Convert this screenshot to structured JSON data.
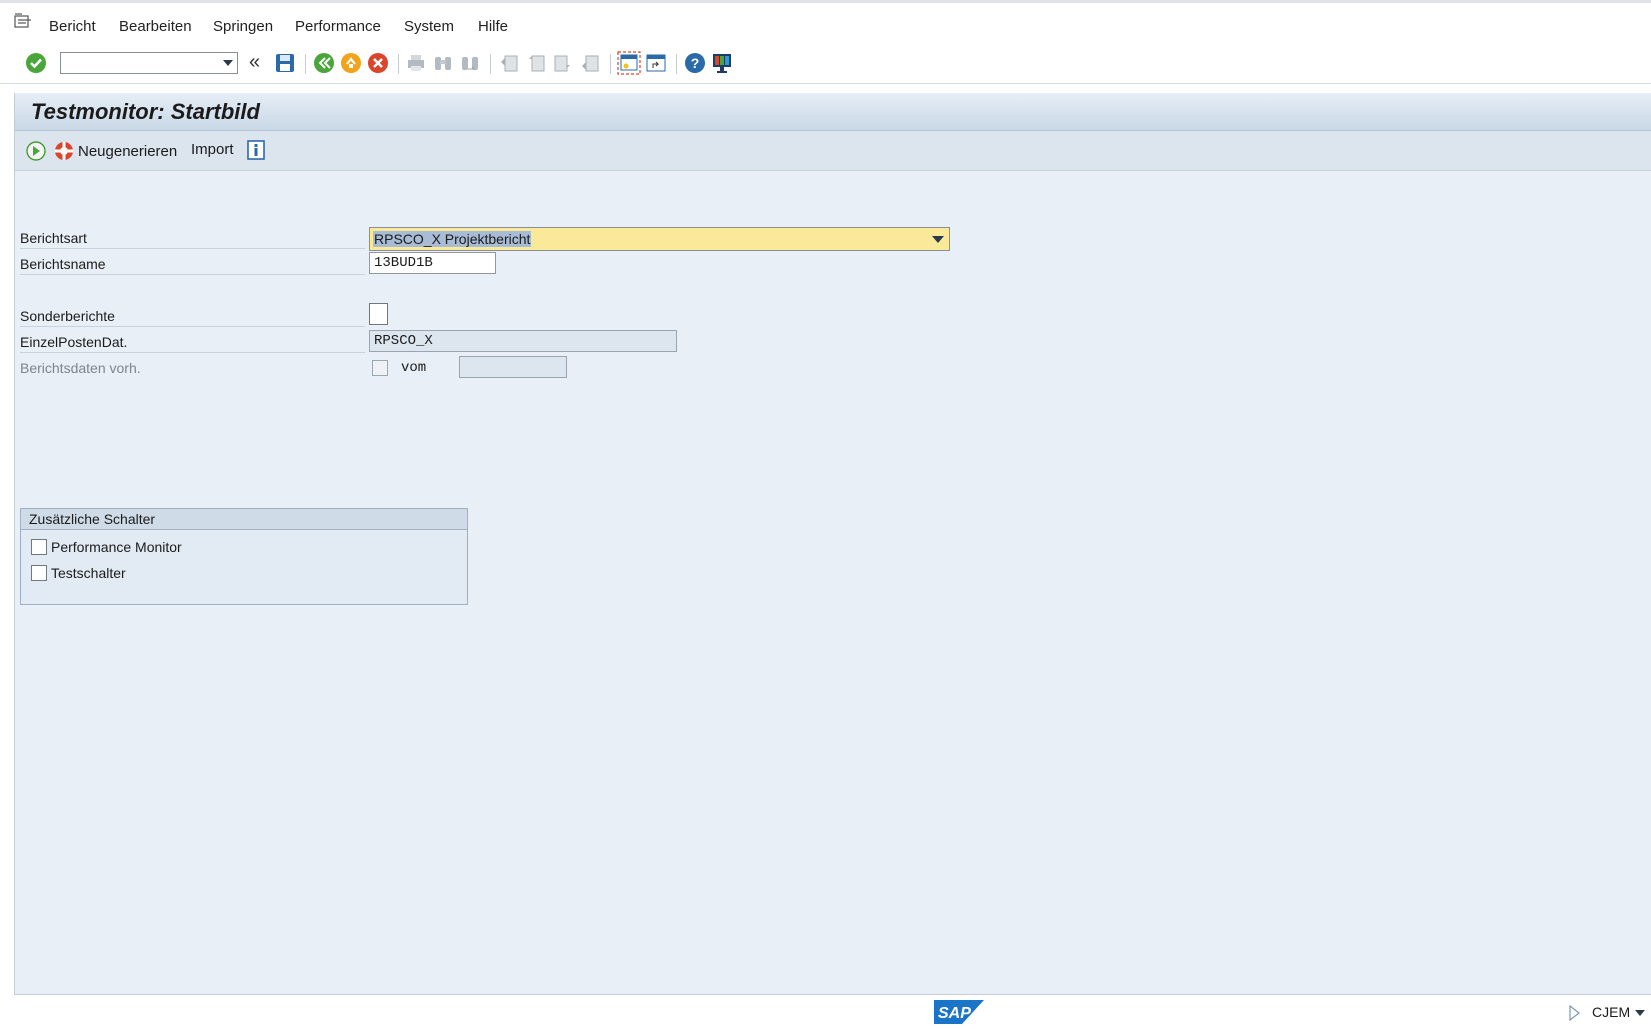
{
  "menubar": {
    "items": [
      "Bericht",
      "Bearbeiten",
      "Springen",
      "Performance",
      "System",
      "Hilfe"
    ]
  },
  "toolbar": {
    "command_field_value": "",
    "collapse_glyph": "«",
    "icons": [
      "enter-icon",
      "save-icon",
      "back-icon",
      "exit-icon",
      "cancel-icon",
      "print-icon",
      "find-icon",
      "find-next-icon",
      "first-page-icon",
      "previous-page-icon",
      "next-page-icon",
      "last-page-icon",
      "new-session-icon",
      "shortcut-icon",
      "help-icon",
      "customize-layout-icon"
    ]
  },
  "screen": {
    "title": "Testmonitor: Startbild",
    "app_toolbar": {
      "execute_icon": "execute-icon",
      "regenerate_label": "Neugenerieren",
      "import_label": "Import",
      "info_icon": "info-icon"
    }
  },
  "form": {
    "berichtsart": {
      "label": "Berichtsart",
      "value": "RPSCO_X Projektbericht"
    },
    "berichtsname": {
      "label": "Berichtsname",
      "value": "13BUD1B"
    },
    "sonderberichte": {
      "label": "Sonderberichte",
      "checked": false
    },
    "einzelpostendat": {
      "label": "EinzelPostenDat.",
      "value": "RPSCO_X"
    },
    "berichtsdaten": {
      "label": "Berichtsdaten vorh.",
      "checked": false,
      "vom_label": "vom",
      "vom_value": ""
    }
  },
  "group": {
    "title": "Zusätzliche Schalter",
    "options": [
      {
        "label": "Performance Monitor",
        "checked": false
      },
      {
        "label": "Testschalter",
        "checked": false
      }
    ]
  },
  "statusbar": {
    "logo_text": "SAP",
    "system": "CJEM"
  },
  "colors": {
    "frame_bg": "#e8eff6",
    "title_bar": "#c9d8e6",
    "focus_field": "#fbe99a",
    "selection": "#a8bcd6"
  }
}
